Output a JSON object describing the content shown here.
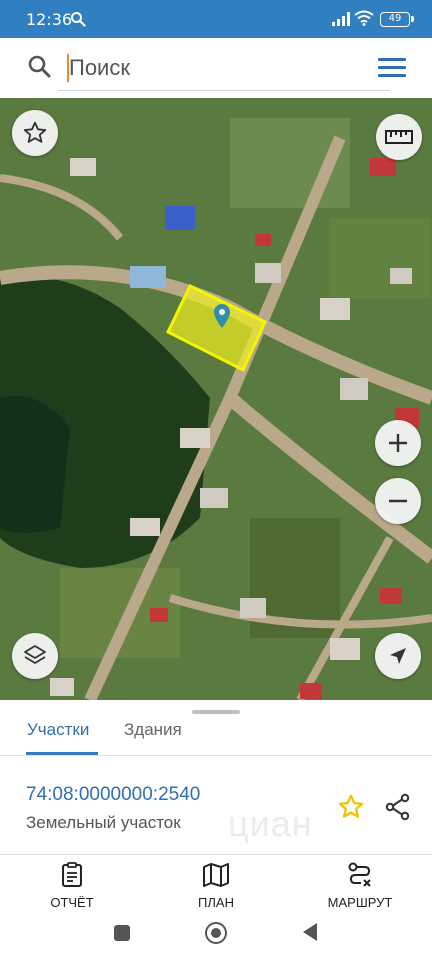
{
  "status_bar": {
    "time": "12:36",
    "battery": "49"
  },
  "search": {
    "placeholder": "Поиск"
  },
  "map": {
    "marker_color": "#2f8fa8",
    "parcel_highlight_color": "#f0f020"
  },
  "sheet": {
    "tabs": [
      {
        "label": "Участки",
        "active": true
      },
      {
        "label": "Здания",
        "active": false
      }
    ],
    "parcel": {
      "cadastral_number": "74:08:0000000:2540",
      "type": "Земельный участок"
    },
    "watermark": "циан"
  },
  "actions": [
    {
      "label": "ОТЧЁТ",
      "icon": "report-icon"
    },
    {
      "label": "ПЛАН",
      "icon": "map-plan-icon"
    },
    {
      "label": "МАРШРУТ",
      "icon": "route-icon"
    }
  ],
  "colors": {
    "status_bar": "#2f7fc1",
    "accent": "#2f6fb2",
    "favorite_star": "#f2c200"
  }
}
